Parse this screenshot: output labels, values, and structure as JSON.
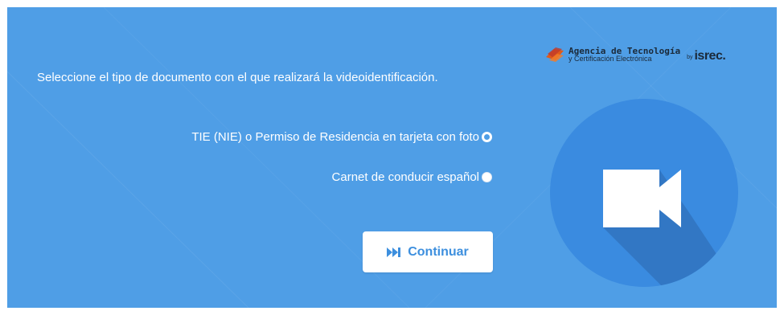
{
  "instruction": "Seleccione el tipo de documento con el que realizará la videoidentificación.",
  "options": [
    {
      "label": "TIE (NIE) o Permiso de Residencia en tarjeta con foto",
      "selected": false
    },
    {
      "label": "Carnet de conducir español",
      "selected": false
    }
  ],
  "continue_button": {
    "label": "Continuar",
    "icon": "fast-forward-icon"
  },
  "logo": {
    "title": "Agencia de Tecnología",
    "subtitle": "y Certificación Electrónica",
    "by": "by",
    "partner": "isrec."
  },
  "colors": {
    "background": "#4f9ee6",
    "circle": "#3a8be0",
    "button_text": "#3d8fde"
  },
  "illustration": {
    "icon": "video-camera-icon"
  }
}
